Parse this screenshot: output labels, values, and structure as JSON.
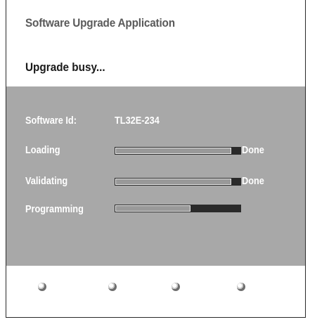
{
  "app_title": "Software Upgrade Application",
  "status": "Upgrade busy...",
  "software_id": {
    "label": "Software Id:",
    "value": "TL32E-234"
  },
  "steps": [
    {
      "label": "Loading",
      "status": "Done",
      "progress": 1.0
    },
    {
      "label": "Validating",
      "status": "Done",
      "progress": 1.0
    },
    {
      "label": "Programming",
      "status": "",
      "progress": 0.6
    }
  ],
  "colors": {
    "panel": "#a8a8a8",
    "bar_track": "#2a2a2a",
    "bar_fill": "#999999",
    "text_light": "#ffffff"
  },
  "footer": {
    "buttons": [
      "red-button-icon",
      "green-button-icon",
      "yellow-button-icon",
      "blue-button-icon"
    ]
  }
}
